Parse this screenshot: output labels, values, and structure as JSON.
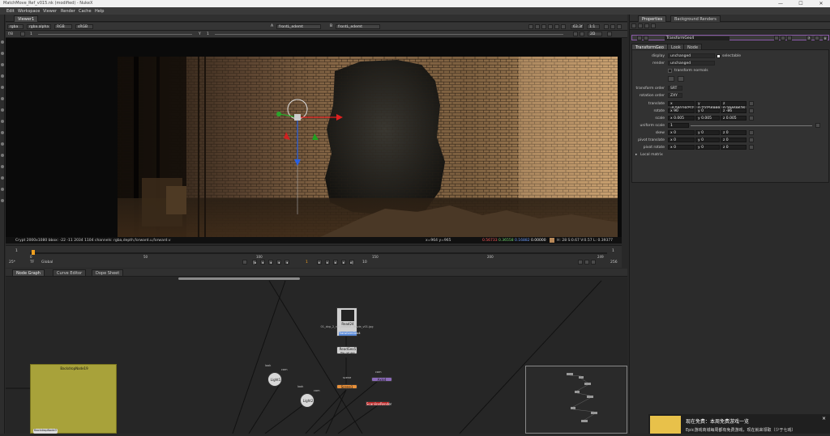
{
  "window": {
    "title": "MatchMove_Ref_v015.nk (modified) - NukeX",
    "controls": [
      "—",
      "☐",
      "✕"
    ]
  },
  "menu": [
    "Edit",
    "Workspace",
    "Viewer",
    "Render",
    "Cache",
    "Help"
  ],
  "viewer": {
    "tab": "Viewer1",
    "layer": "rgba",
    "channel": "rgba.alpha",
    "display": "RGB",
    "colorspace": "sRGB",
    "input_a": "A",
    "input_a_node": "frontL_edemt",
    "input_b": "B",
    "input_b_node": "frontL_edemt",
    "fstop_label": "f/8",
    "frame_label": "1",
    "y_label": "Y",
    "gain_value": "1",
    "zoom": "2D",
    "proxy": "63.3f",
    "scale": "1:1",
    "info_left": "Crypt 2000x1080  bbox: -22 -11 2034 1104 channels: rgba,depth,forward.u,forward.v",
    "info_xy": "x=964 y=965",
    "info_r": "0.56733",
    "info_g": "0.36558",
    "info_b": "0.16882",
    "info_a": "0.00000",
    "info_hsv": "H: 28 S:0.67 V:0.57  L: 0.39377",
    "handle_colors": {
      "x": "#e02020",
      "y": "#2aa52a",
      "z": "#2860e0"
    }
  },
  "timeline": {
    "start_marker": "1",
    "tick_labels": [
      "0",
      "50",
      "100",
      "150",
      "200",
      "249"
    ],
    "end_marker": "1",
    "fps": "25*",
    "tf": "TF",
    "scope": "Global",
    "current_frame": "1",
    "step": "10",
    "end_frame": "256"
  },
  "panels": {
    "tabs": [
      "Node Graph",
      "Curve Editor",
      "Dope Sheet"
    ]
  },
  "nodes": {
    "backdrop_label": "BackdropNode19",
    "backdrop_bottom_label": "BackdropNode3",
    "read_label": "Read24",
    "read_path": "01_dvp_2_ref_diffshot_Movie_v01.jpg",
    "read_badge": "TransformGeo4",
    "readgeo_label": "ReadGeo5",
    "readgeo_sub": "file: ref_geo",
    "light1": "Light1",
    "light2": "Light2",
    "light1_label": "look",
    "light1_label2": "cam",
    "light2_label": "look",
    "light2_label2": "cam",
    "scene_label": "scene",
    "scene_node": "Scene1",
    "cam_label": "cam",
    "axis_node": "Axis4",
    "write_node": "ScanlineRender"
  },
  "properties": {
    "tabs": [
      "Properties",
      "Background Renders"
    ],
    "node_name": "TransformGeo4",
    "subtabs": [
      "TransformGeo",
      "Look",
      "Node"
    ],
    "display_label": "display",
    "display_value": "unchanged",
    "selectable_label": "selectable",
    "render_label": "render",
    "render_value": "unchanged",
    "transform_normals": "transform normals",
    "transform_order_label": "transform order",
    "transform_order_value": "SRT",
    "rotation_order_label": "rotation order",
    "rotation_order_value": "ZXY",
    "translate_label": "translate",
    "translate_x": "x -0.59119757",
    "translate_y": "y 0.73756988",
    "translate_z": "z 0.29469676",
    "rotate_label": "rotate",
    "rotate_x": "x 90",
    "rotate_y": "y 0",
    "rotate_z": "z -86",
    "scale_label": "scale",
    "scale_x": "x 0.005",
    "scale_y": "y 0.005",
    "scale_z": "z 0.005",
    "uniform_scale_label": "uniform scale",
    "uniform_scale_value": "1",
    "skew_label": "skew",
    "skew_x": "x 0",
    "skew_y": "y 0",
    "skew_z": "z 0",
    "pivot_translate_label": "pivot translate",
    "pt_x": "x 0",
    "pt_y": "y 0",
    "pt_z": "z 0",
    "pivot_rotate_label": "pivot rotate",
    "pr_x": "x 0",
    "pr_y": "y 0",
    "pr_z": "z 0",
    "local_matrix": "Local matrix"
  },
  "notification": {
    "title": "现在免费：本周免费游戏一览",
    "subtitle": "Epic游戏商城每周都有免费游戏，现在就来领取（少于七戏）"
  }
}
